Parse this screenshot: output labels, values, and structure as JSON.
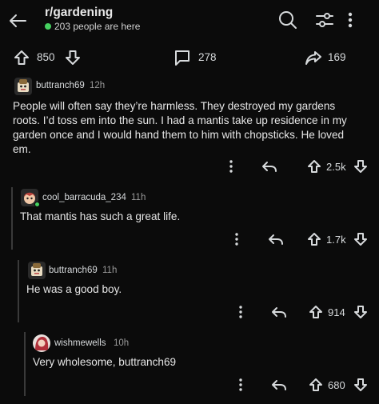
{
  "header": {
    "title": "r/gardening",
    "online_text": "203 people are here"
  },
  "post_actions": {
    "upvotes": "850",
    "comments": "278",
    "shares": "169"
  },
  "comments": [
    {
      "user": "buttranch69",
      "age": "12h",
      "body": "People will often say they’re harmless. They destroyed my gardens roots. I’d toss em into the sun. I had a mantis take up residence in my garden once and I would hand them to him with chopsticks. He loved em.",
      "score": "2.5k"
    },
    {
      "user": "cool_barracuda_234",
      "age": "11h",
      "body": "That mantis has such a great life.",
      "score": "1.7k"
    },
    {
      "user": "buttranch69",
      "age": "11h",
      "body": "He was a good boy.",
      "score": "914"
    },
    {
      "user": "wishmewells",
      "age": "10h",
      "body": "Very wholesome, buttranch69",
      "score": "680"
    }
  ],
  "icons": {
    "back": "arrow-left-icon",
    "search": "search-icon",
    "filter": "sliders-icon",
    "more": "more-vertical-icon",
    "upvote": "arrow-up-icon",
    "downvote": "arrow-down-icon",
    "comment": "speech-bubble-icon",
    "share": "share-arrow-icon",
    "reply": "reply-icon"
  },
  "colors": {
    "background": "#0b0b0b",
    "text": "#d7dadc",
    "online": "#46d160"
  }
}
